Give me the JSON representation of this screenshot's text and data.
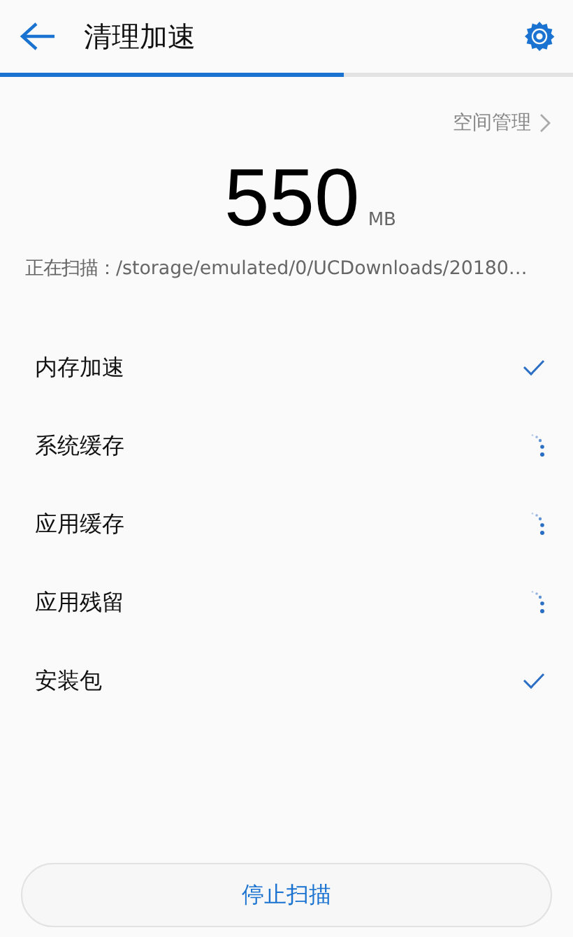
{
  "header": {
    "title": "清理加速"
  },
  "progress": {
    "level": 0.6
  },
  "storage_link": {
    "label": "空间管理"
  },
  "summary": {
    "amount": "550",
    "unit": "MB",
    "scanning": "正在扫描：/storage/emulated/0/UCDownloads/20180…"
  },
  "items": [
    {
      "label": "内存加速",
      "done": true
    },
    {
      "label": "系统缓存",
      "done": false
    },
    {
      "label": "应用缓存",
      "done": false
    },
    {
      "label": "应用残留",
      "done": false
    },
    {
      "label": "安装包",
      "done": true
    }
  ],
  "button": {
    "label": "停止扫描"
  }
}
